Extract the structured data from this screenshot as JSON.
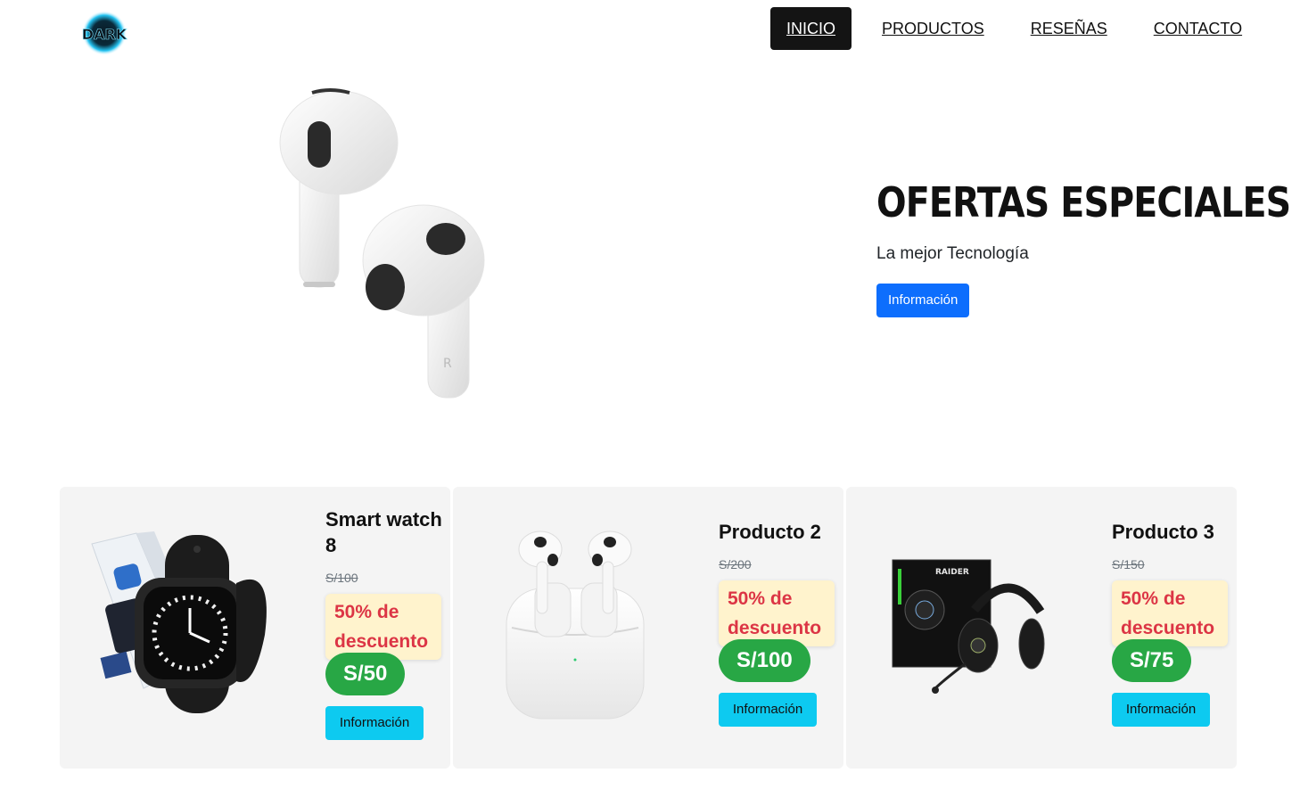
{
  "brand": {
    "logo_text": "DARK"
  },
  "nav": {
    "items": [
      {
        "label": "INICIO",
        "active": true
      },
      {
        "label": "PRODUCTOS"
      },
      {
        "label": "RESEÑAS"
      },
      {
        "label": "CONTACTO"
      }
    ]
  },
  "hero": {
    "title": "OFERTAS ESPECIALES",
    "subtitle": "La mejor Tecnología",
    "button_label": "Información",
    "image_icon": "earbuds-image"
  },
  "products": [
    {
      "name": "Smart watch 8",
      "old_price": "S/100",
      "discount": "50% de descuento",
      "price": "S/50",
      "button_label": "Información",
      "image_icon": "smartwatch-image"
    },
    {
      "name": "Producto 2",
      "old_price": "S/200",
      "discount": "50% de descuento",
      "price": "S/100",
      "button_label": "Información",
      "image_icon": "airpods-case-image"
    },
    {
      "name": "Producto 3",
      "old_price": "S/150",
      "discount": "50% de descuento",
      "price": "S/75",
      "button_label": "Información",
      "image_icon": "headset-image"
    }
  ],
  "colors": {
    "primary": "#0d6efd",
    "info": "#0dcaf0",
    "success": "#28a745",
    "danger": "#dc3545",
    "warning_bg": "#fff3cd",
    "nav_active": "#141414"
  }
}
